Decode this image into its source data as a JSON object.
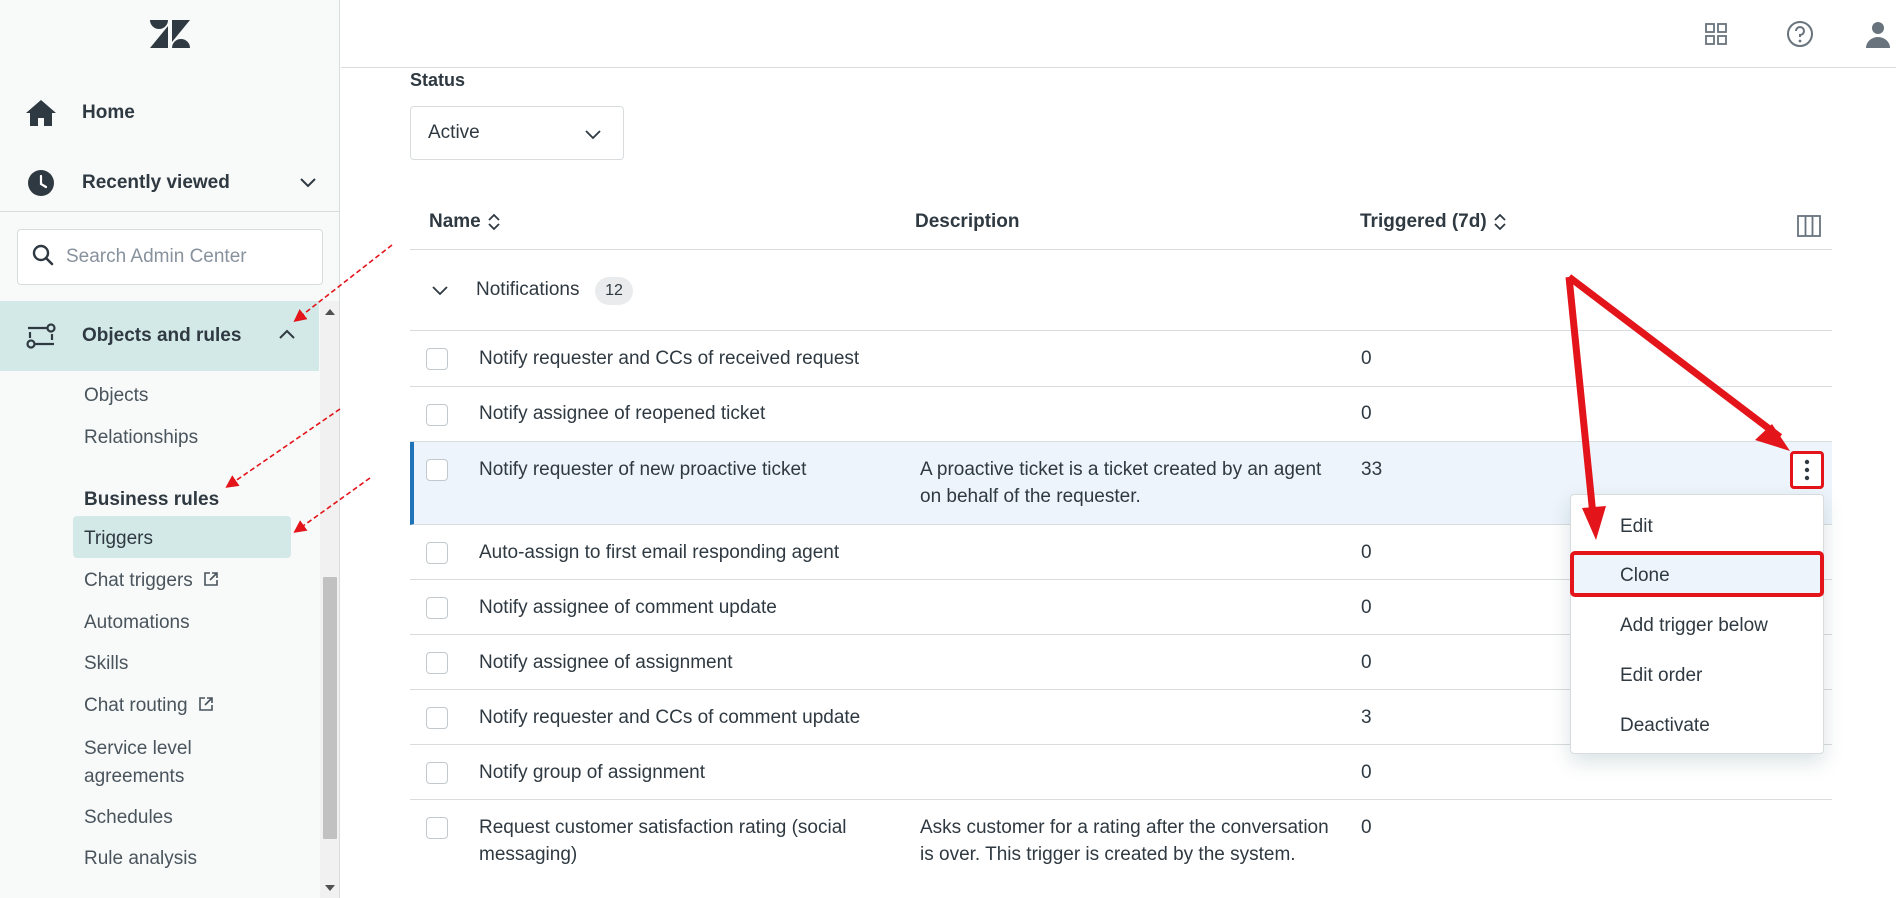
{
  "sidebar": {
    "logo": "zendesk-logo",
    "nav": [
      {
        "label": "Home",
        "icon": "home-icon"
      },
      {
        "label": "Recently viewed",
        "icon": "clock-icon"
      }
    ],
    "search_placeholder": "Search Admin Center",
    "section": {
      "label": "Objects and rules",
      "icon": "objects-rules-icon"
    },
    "sub_items": {
      "objects": "Objects",
      "relationships": "Relationships",
      "business_rules": "Business rules",
      "triggers": "Triggers",
      "chat_triggers": "Chat triggers",
      "automations": "Automations",
      "skills": "Skills",
      "chat_routing": "Chat routing",
      "sla_line1": "Service level",
      "sla_line2": "agreements",
      "schedules": "Schedules",
      "rule_analysis": "Rule analysis"
    }
  },
  "topbar": {
    "icons": [
      "products-grid-icon",
      "help-icon",
      "user-icon"
    ]
  },
  "filter": {
    "status_label": "Status",
    "status_value": "Active"
  },
  "table": {
    "headers": {
      "name": "Name",
      "description": "Description",
      "triggered": "Triggered (7d)"
    },
    "group": {
      "name": "Notifications",
      "count": "12"
    },
    "rows": [
      {
        "name": "Notify requester and CCs of received request",
        "description": "",
        "triggered": "0"
      },
      {
        "name": "Notify assignee of reopened ticket",
        "description": "",
        "triggered": "0"
      },
      {
        "name": "Notify requester of new proactive ticket",
        "description": "A proactive ticket is a ticket created by an agent on behalf of the requester.",
        "triggered": "33"
      },
      {
        "name": "Auto-assign to first email responding agent",
        "description": "",
        "triggered": "0"
      },
      {
        "name": "Notify assignee of comment update",
        "description": "",
        "triggered": "0"
      },
      {
        "name": "Notify assignee of assignment",
        "description": "",
        "triggered": "0"
      },
      {
        "name": "Notify requester and CCs of comment update",
        "description": "",
        "triggered": "3"
      },
      {
        "name": "Notify group of assignment",
        "description": "",
        "triggered": "0"
      },
      {
        "name": "Request customer satisfaction rating (social messaging)",
        "description": "Asks customer for a rating after the conversation is over. This trigger is created by the system.",
        "triggered": "0"
      }
    ]
  },
  "menu": {
    "items": [
      "Edit",
      "Clone",
      "Add trigger below",
      "Edit order",
      "Deactivate"
    ]
  },
  "colors": {
    "accent_green": "#d3e9e7",
    "annotation_red": "#e3141a",
    "selected_row": "#edf4fb",
    "selected_border": "#1f73b7"
  }
}
